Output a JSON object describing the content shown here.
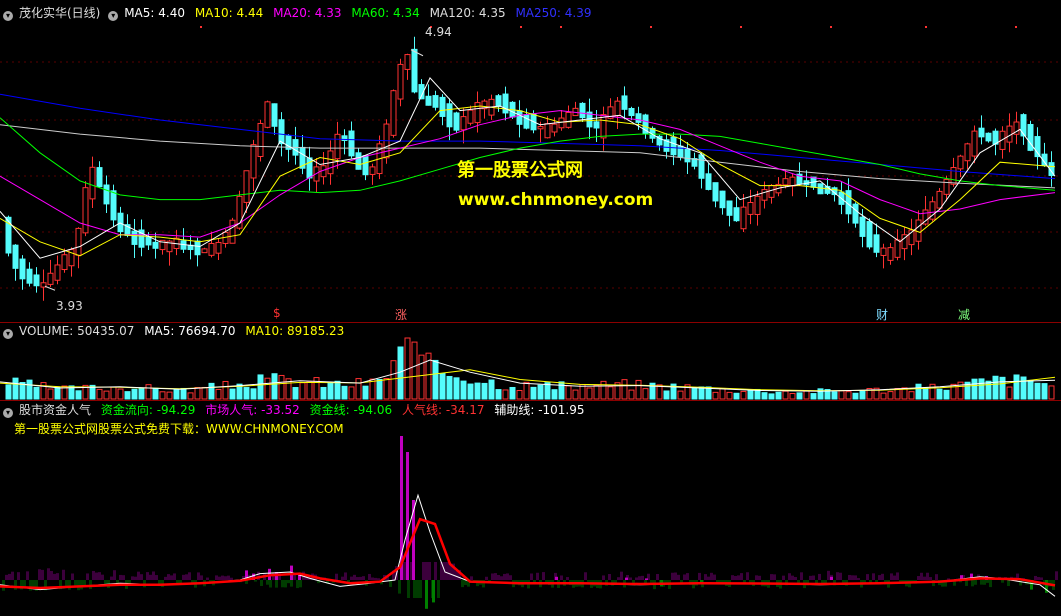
{
  "price_header": {
    "title": "茂化实华(日线)",
    "ma5": "MA5: 4.40",
    "ma10": "MA10: 4.44",
    "ma20": "MA20: 4.33",
    "ma60": "MA60: 4.34",
    "ma120": "MA120: 4.35",
    "ma250": "MA250: 4.39"
  },
  "price_annotations": {
    "high": "4.94",
    "low": "3.93"
  },
  "event_marks": [
    "$",
    "涨",
    "财",
    "减"
  ],
  "watermark": {
    "line1": "第一股票公式网",
    "line2": "www.chnmoney.com"
  },
  "volume_header": {
    "title": "VOLUME: 50435.07",
    "ma5": "MA5: 76694.70",
    "ma10": "MA10: 89185.23"
  },
  "indicator_header": {
    "title": "股市资金人气",
    "flow": "资金流向: -94.29",
    "popularity": "市场人气: -33.52",
    "fund_line": "资金线: -94.06",
    "pop_line": "人气线: -34.17",
    "aux_line": "辅助线: -101.95",
    "subtitle": "第一股票公式网股票公式免费下载：WWW.CHNMONEY.COM"
  },
  "colors": {
    "up": "#ff3232",
    "down": "#54fcfc",
    "ma5": "#ffffff",
    "ma10": "#ffff00",
    "ma20": "#ff00ff",
    "ma60": "#00ff00",
    "ma120": "#cccccc",
    "ma250": "#0000ff",
    "pop_line": "#ff0000",
    "flow_bar_up": "#c000c0",
    "flow_bar_down": "#008000",
    "fill_pos": "#3c003c",
    "fill_neg": "#003c00"
  },
  "chart_data": [
    {
      "type": "candlestick",
      "ylim": [
        3.85,
        5.05
      ],
      "price_points": [
        [
          0,
          4.3
        ],
        [
          15,
          4.05
        ],
        [
          30,
          3.95
        ],
        [
          45,
          3.93
        ],
        [
          60,
          4.0
        ],
        [
          80,
          4.1
        ],
        [
          95,
          4.45
        ],
        [
          105,
          4.35
        ],
        [
          120,
          4.2
        ],
        [
          140,
          4.12
        ],
        [
          160,
          4.1
        ],
        [
          180,
          4.12
        ],
        [
          200,
          4.08
        ],
        [
          220,
          4.1
        ],
        [
          235,
          4.18
        ],
        [
          250,
          4.4
        ],
        [
          260,
          4.55
        ],
        [
          272,
          4.7
        ],
        [
          285,
          4.55
        ],
        [
          300,
          4.5
        ],
        [
          315,
          4.4
        ],
        [
          330,
          4.45
        ],
        [
          345,
          4.6
        ],
        [
          360,
          4.45
        ],
        [
          375,
          4.4
        ],
        [
          390,
          4.6
        ],
        [
          403,
          4.85
        ],
        [
          411,
          4.94
        ],
        [
          420,
          4.75
        ],
        [
          440,
          4.7
        ],
        [
          460,
          4.6
        ],
        [
          480,
          4.7
        ],
        [
          500,
          4.72
        ],
        [
          520,
          4.65
        ],
        [
          540,
          4.6
        ],
        [
          560,
          4.62
        ],
        [
          580,
          4.68
        ],
        [
          600,
          4.6
        ],
        [
          620,
          4.72
        ],
        [
          640,
          4.65
        ],
        [
          660,
          4.55
        ],
        [
          680,
          4.5
        ],
        [
          700,
          4.45
        ],
        [
          720,
          4.3
        ],
        [
          740,
          4.22
        ],
        [
          760,
          4.3
        ],
        [
          780,
          4.36
        ],
        [
          800,
          4.38
        ],
        [
          820,
          4.35
        ],
        [
          840,
          4.33
        ],
        [
          860,
          4.2
        ],
        [
          880,
          4.08
        ],
        [
          900,
          4.1
        ],
        [
          920,
          4.18
        ],
        [
          940,
          4.3
        ],
        [
          960,
          4.45
        ],
        [
          980,
          4.58
        ],
        [
          1000,
          4.55
        ],
        [
          1020,
          4.62
        ],
        [
          1040,
          4.5
        ],
        [
          1055,
          4.42
        ]
      ],
      "ma5_points": [
        [
          0,
          4.25
        ],
        [
          40,
          4.05
        ],
        [
          80,
          4.1
        ],
        [
          120,
          4.2
        ],
        [
          160,
          4.12
        ],
        [
          200,
          4.1
        ],
        [
          240,
          4.2
        ],
        [
          280,
          4.55
        ],
        [
          320,
          4.45
        ],
        [
          360,
          4.48
        ],
        [
          400,
          4.55
        ],
        [
          430,
          4.82
        ],
        [
          460,
          4.68
        ],
        [
          500,
          4.7
        ],
        [
          540,
          4.62
        ],
        [
          580,
          4.64
        ],
        [
          620,
          4.66
        ],
        [
          660,
          4.56
        ],
        [
          700,
          4.5
        ],
        [
          740,
          4.3
        ],
        [
          780,
          4.35
        ],
        [
          820,
          4.38
        ],
        [
          860,
          4.24
        ],
        [
          900,
          4.12
        ],
        [
          940,
          4.26
        ],
        [
          980,
          4.5
        ],
        [
          1020,
          4.6
        ],
        [
          1055,
          4.4
        ]
      ],
      "ma10_points": [
        [
          0,
          4.22
        ],
        [
          40,
          4.12
        ],
        [
          80,
          4.06
        ],
        [
          120,
          4.15
        ],
        [
          160,
          4.14
        ],
        [
          200,
          4.12
        ],
        [
          240,
          4.15
        ],
        [
          280,
          4.4
        ],
        [
          320,
          4.48
        ],
        [
          360,
          4.45
        ],
        [
          400,
          4.5
        ],
        [
          440,
          4.68
        ],
        [
          480,
          4.7
        ],
        [
          520,
          4.68
        ],
        [
          560,
          4.63
        ],
        [
          600,
          4.64
        ],
        [
          640,
          4.62
        ],
        [
          680,
          4.56
        ],
        [
          720,
          4.45
        ],
        [
          760,
          4.36
        ],
        [
          800,
          4.36
        ],
        [
          840,
          4.34
        ],
        [
          880,
          4.22
        ],
        [
          920,
          4.16
        ],
        [
          960,
          4.3
        ],
        [
          1000,
          4.46
        ],
        [
          1055,
          4.44
        ]
      ],
      "ma20_points": [
        [
          0,
          4.4
        ],
        [
          40,
          4.3
        ],
        [
          80,
          4.2
        ],
        [
          120,
          4.15
        ],
        [
          160,
          4.15
        ],
        [
          200,
          4.14
        ],
        [
          240,
          4.2
        ],
        [
          280,
          4.32
        ],
        [
          320,
          4.42
        ],
        [
          360,
          4.48
        ],
        [
          400,
          4.52
        ],
        [
          440,
          4.56
        ],
        [
          480,
          4.62
        ],
        [
          520,
          4.66
        ],
        [
          560,
          4.68
        ],
        [
          600,
          4.66
        ],
        [
          640,
          4.64
        ],
        [
          680,
          4.6
        ],
        [
          720,
          4.53
        ],
        [
          760,
          4.46
        ],
        [
          800,
          4.4
        ],
        [
          840,
          4.38
        ],
        [
          880,
          4.3
        ],
        [
          920,
          4.24
        ],
        [
          960,
          4.26
        ],
        [
          1000,
          4.3
        ],
        [
          1055,
          4.33
        ]
      ],
      "ma60_points": [
        [
          0,
          4.65
        ],
        [
          40,
          4.5
        ],
        [
          80,
          4.38
        ],
        [
          120,
          4.32
        ],
        [
          160,
          4.3
        ],
        [
          200,
          4.3
        ],
        [
          240,
          4.32
        ],
        [
          280,
          4.34
        ],
        [
          320,
          4.33
        ],
        [
          360,
          4.34
        ],
        [
          400,
          4.38
        ],
        [
          440,
          4.43
        ],
        [
          480,
          4.48
        ],
        [
          520,
          4.52
        ],
        [
          560,
          4.55
        ],
        [
          600,
          4.57
        ],
        [
          640,
          4.58
        ],
        [
          680,
          4.58
        ],
        [
          720,
          4.57
        ],
        [
          760,
          4.54
        ],
        [
          800,
          4.51
        ],
        [
          840,
          4.48
        ],
        [
          880,
          4.45
        ],
        [
          920,
          4.41
        ],
        [
          960,
          4.38
        ],
        [
          1000,
          4.36
        ],
        [
          1055,
          4.34
        ]
      ],
      "ma120_points": [
        [
          0,
          4.62
        ],
        [
          80,
          4.58
        ],
        [
          160,
          4.55
        ],
        [
          240,
          4.53
        ],
        [
          320,
          4.52
        ],
        [
          400,
          4.52
        ],
        [
          480,
          4.52
        ],
        [
          560,
          4.51
        ],
        [
          640,
          4.5
        ],
        [
          720,
          4.46
        ],
        [
          800,
          4.42
        ],
        [
          880,
          4.39
        ],
        [
          960,
          4.37
        ],
        [
          1055,
          4.35
        ]
      ],
      "ma250_points": [
        [
          0,
          4.75
        ],
        [
          80,
          4.69
        ],
        [
          160,
          4.64
        ],
        [
          240,
          4.6
        ],
        [
          320,
          4.56
        ],
        [
          400,
          4.55
        ],
        [
          480,
          4.55
        ],
        [
          560,
          4.54
        ],
        [
          640,
          4.53
        ],
        [
          720,
          4.51
        ],
        [
          800,
          4.48
        ],
        [
          880,
          4.45
        ],
        [
          960,
          4.42
        ],
        [
          1055,
          4.39
        ]
      ]
    },
    {
      "type": "bar",
      "ylim": [
        0,
        250000
      ],
      "volume_points": [
        [
          0,
          70000
        ],
        [
          60,
          40000
        ],
        [
          120,
          50000
        ],
        [
          180,
          35000
        ],
        [
          240,
          60000
        ],
        [
          270,
          80000
        ],
        [
          300,
          70000
        ],
        [
          340,
          60000
        ],
        [
          380,
          70000
        ],
        [
          400,
          230000
        ],
        [
          410,
          200000
        ],
        [
          430,
          120000
        ],
        [
          460,
          100000
        ],
        [
          500,
          60000
        ],
        [
          560,
          50000
        ],
        [
          620,
          60000
        ],
        [
          680,
          50000
        ],
        [
          740,
          35000
        ],
        [
          800,
          30000
        ],
        [
          860,
          35000
        ],
        [
          920,
          45000
        ],
        [
          960,
          60000
        ],
        [
          1000,
          80000
        ],
        [
          1040,
          70000
        ],
        [
          1055,
          50000
        ]
      ],
      "ma5_points": [
        [
          0,
          70000
        ],
        [
          60,
          45000
        ],
        [
          120,
          50000
        ],
        [
          180,
          40000
        ],
        [
          240,
          55000
        ],
        [
          300,
          75000
        ],
        [
          360,
          65000
        ],
        [
          400,
          110000
        ],
        [
          430,
          160000
        ],
        [
          470,
          110000
        ],
        [
          520,
          65000
        ],
        [
          580,
          52000
        ],
        [
          640,
          55000
        ],
        [
          700,
          45000
        ],
        [
          760,
          35000
        ],
        [
          820,
          32000
        ],
        [
          880,
          38000
        ],
        [
          940,
          50000
        ],
        [
          1000,
          70000
        ],
        [
          1055,
          76694
        ]
      ],
      "ma10_points": [
        [
          0,
          65000
        ],
        [
          60,
          50000
        ],
        [
          120,
          48000
        ],
        [
          180,
          42000
        ],
        [
          240,
          52000
        ],
        [
          300,
          68000
        ],
        [
          360,
          66000
        ],
        [
          420,
          95000
        ],
        [
          470,
          120000
        ],
        [
          520,
          80000
        ],
        [
          580,
          60000
        ],
        [
          640,
          56000
        ],
        [
          700,
          48000
        ],
        [
          760,
          38000
        ],
        [
          820,
          34000
        ],
        [
          880,
          36000
        ],
        [
          940,
          46000
        ],
        [
          1000,
          62000
        ],
        [
          1055,
          89185
        ]
      ]
    },
    {
      "type": "line",
      "ylim": [
        -200,
        1000
      ],
      "aux_points": [
        [
          0,
          -30
        ],
        [
          40,
          -60
        ],
        [
          80,
          -40
        ],
        [
          120,
          -20
        ],
        [
          160,
          -30
        ],
        [
          200,
          -20
        ],
        [
          240,
          0
        ],
        [
          260,
          40
        ],
        [
          290,
          50
        ],
        [
          310,
          10
        ],
        [
          340,
          -40
        ],
        [
          370,
          -20
        ],
        [
          395,
          0
        ],
        [
          405,
          250
        ],
        [
          418,
          530
        ],
        [
          430,
          300
        ],
        [
          445,
          50
        ],
        [
          470,
          -10
        ],
        [
          520,
          -20
        ],
        [
          580,
          -20
        ],
        [
          640,
          -30
        ],
        [
          700,
          -20
        ],
        [
          760,
          -20
        ],
        [
          820,
          -30
        ],
        [
          880,
          -20
        ],
        [
          940,
          -10
        ],
        [
          980,
          20
        ],
        [
          1000,
          10
        ],
        [
          1040,
          -30
        ],
        [
          1055,
          -102
        ]
      ],
      "pop_points": [
        [
          0,
          -40
        ],
        [
          40,
          -50
        ],
        [
          80,
          -40
        ],
        [
          120,
          -30
        ],
        [
          160,
          -30
        ],
        [
          200,
          -20
        ],
        [
          240,
          -5
        ],
        [
          270,
          30
        ],
        [
          300,
          40
        ],
        [
          320,
          10
        ],
        [
          350,
          -20
        ],
        [
          380,
          -10
        ],
        [
          400,
          80
        ],
        [
          420,
          380
        ],
        [
          435,
          350
        ],
        [
          450,
          100
        ],
        [
          470,
          -10
        ],
        [
          520,
          -20
        ],
        [
          580,
          -20
        ],
        [
          640,
          -25
        ],
        [
          700,
          -20
        ],
        [
          760,
          -22
        ],
        [
          820,
          -25
        ],
        [
          880,
          -20
        ],
        [
          940,
          -10
        ],
        [
          980,
          10
        ],
        [
          1020,
          5
        ],
        [
          1055,
          -34
        ]
      ],
      "flow_bars": [
        [
          245,
          60
        ],
        [
          252,
          40
        ],
        [
          268,
          70
        ],
        [
          275,
          50
        ],
        [
          290,
          90
        ],
        [
          298,
          40
        ],
        [
          400,
          900
        ],
        [
          406,
          800
        ],
        [
          412,
          500
        ],
        [
          425,
          -180
        ],
        [
          432,
          -140
        ],
        [
          555,
          20
        ],
        [
          625,
          15
        ],
        [
          645,
          10
        ],
        [
          660,
          -40
        ],
        [
          700,
          -20
        ],
        [
          830,
          20
        ],
        [
          960,
          30
        ],
        [
          970,
          40
        ],
        [
          985,
          25
        ],
        [
          1030,
          -60
        ],
        [
          1045,
          -80
        ]
      ]
    }
  ]
}
